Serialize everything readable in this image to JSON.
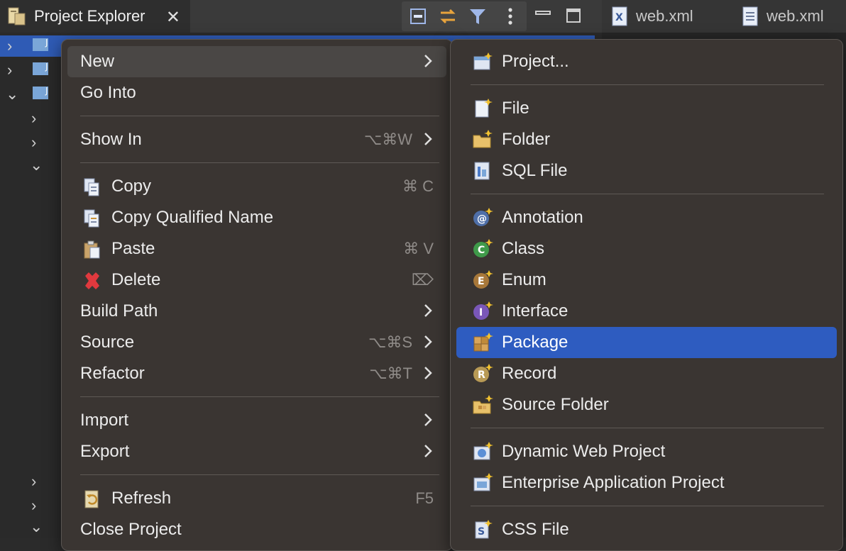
{
  "view_tab": {
    "title": "Project Explorer",
    "close": "✕"
  },
  "editor_tabs": [
    {
      "label": "web.xml",
      "icon": "xml-file-icon"
    },
    {
      "label": "web.xml",
      "icon": "text-file-icon"
    }
  ],
  "context_menu": {
    "items": [
      {
        "label": "New",
        "has_submenu": true
      },
      {
        "label": "Go Into"
      },
      {
        "label": "Show In",
        "shortcut": "⌥⌘W",
        "has_submenu": true
      },
      {
        "label": "Copy",
        "shortcut": "⌘ C",
        "icon": "copy-icon"
      },
      {
        "label": "Copy Qualified Name",
        "icon": "copy-qualified-name-icon"
      },
      {
        "label": "Paste",
        "shortcut": "⌘ V",
        "icon": "paste-icon"
      },
      {
        "label": "Delete",
        "shortcut": "⌦",
        "icon": "delete-icon"
      },
      {
        "label": "Build Path",
        "has_submenu": true
      },
      {
        "label": "Source",
        "shortcut": "⌥⌘S",
        "has_submenu": true
      },
      {
        "label": "Refactor",
        "shortcut": "⌥⌘T",
        "has_submenu": true
      },
      {
        "label": "Import",
        "has_submenu": true
      },
      {
        "label": "Export",
        "has_submenu": true
      },
      {
        "label": "Refresh",
        "shortcut": "F5",
        "icon": "refresh-icon"
      },
      {
        "label": "Close Project"
      }
    ]
  },
  "new_submenu": {
    "items": [
      {
        "label": "Project...",
        "icon": "new-project-icon"
      },
      {
        "label": "File",
        "icon": "new-file-icon"
      },
      {
        "label": "Folder",
        "icon": "new-folder-icon"
      },
      {
        "label": "SQL File",
        "icon": "sql-file-icon"
      },
      {
        "label": "Annotation",
        "icon": "annotation-icon"
      },
      {
        "label": "Class",
        "icon": "class-icon"
      },
      {
        "label": "Enum",
        "icon": "enum-icon"
      },
      {
        "label": "Interface",
        "icon": "interface-icon"
      },
      {
        "label": "Package",
        "icon": "package-icon",
        "selected": true
      },
      {
        "label": "Record",
        "icon": "record-icon"
      },
      {
        "label": "Source Folder",
        "icon": "source-folder-icon"
      },
      {
        "label": "Dynamic Web Project",
        "icon": "dynamic-web-project-icon"
      },
      {
        "label": "Enterprise Application Project",
        "icon": "enterprise-application-project-icon"
      },
      {
        "label": "CSS File",
        "icon": "css-file-icon"
      }
    ]
  },
  "colors": {
    "selection": "#2e5cc0",
    "menu_bg": "#3a3532",
    "tree_selection": "#2f5bb5"
  }
}
